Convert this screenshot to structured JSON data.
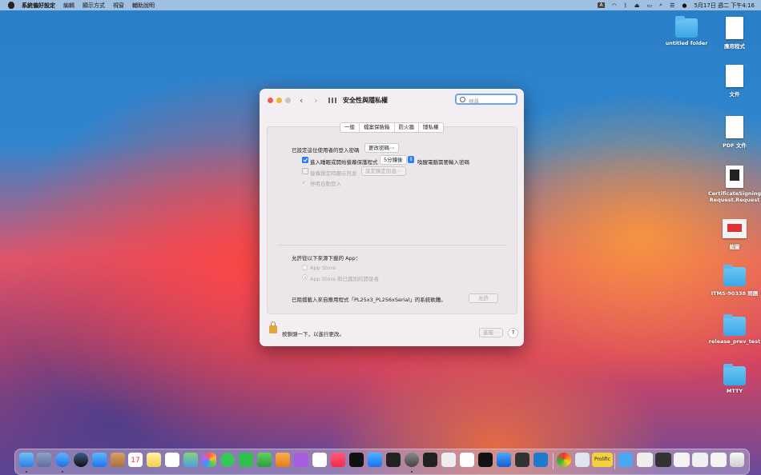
{
  "menubar": {
    "app": "系統偏好設定",
    "items": [
      "編輯",
      "顯示方式",
      "視窗",
      "輔助說明"
    ],
    "status_a": "A",
    "clock": "5月17日 週二 下午4:16"
  },
  "desktop": {
    "items": [
      {
        "label": "untitled folder"
      },
      {
        "label": "應用程式"
      },
      {
        "label": "文件"
      },
      {
        "label": "PDF 文件"
      },
      {
        "label": "CertificateSigningRequest.Request"
      },
      {
        "label": "截圖"
      },
      {
        "label": "ITMS-90338 問題"
      },
      {
        "label": "release_prev_test"
      },
      {
        "label": "MTTY"
      }
    ]
  },
  "window": {
    "title": "安全性與隱私權",
    "search_placeholder": "搜尋",
    "tabs": [
      "一般",
      "檔案保險箱",
      "防火牆",
      "隱私權"
    ],
    "password_label": "已設定這位使用者的登入密碼",
    "change_password_button": "更改密碼⋯",
    "require_password_label": "進入睡眠或開始螢幕保護程式",
    "require_password_delay": "5分鐘後",
    "require_password_suffix": "喚醒電腦需要輸入密碼",
    "show_message_label": "螢幕鎖定時顯示訊息",
    "set_lock_message_button": "設定鎖定訊息⋯",
    "disable_autologin_label": "停用自動登入",
    "allow_apps_label": "允許從以下來源下載的 App：",
    "option_app_store": "App Store",
    "option_identified": "App Store 和已識別的開發者",
    "blocked_message": "已阻擋載入來自應用程式「PL25x3_PL256xSerial」的系統軟體。",
    "allow_button": "允許",
    "lock_label": "按鎖頭一下，以進行更改。",
    "advanced_button": "進階⋯",
    "help_label": "?"
  },
  "dock": {
    "prolific_label": "Prolific",
    "calendar_day": "17"
  }
}
